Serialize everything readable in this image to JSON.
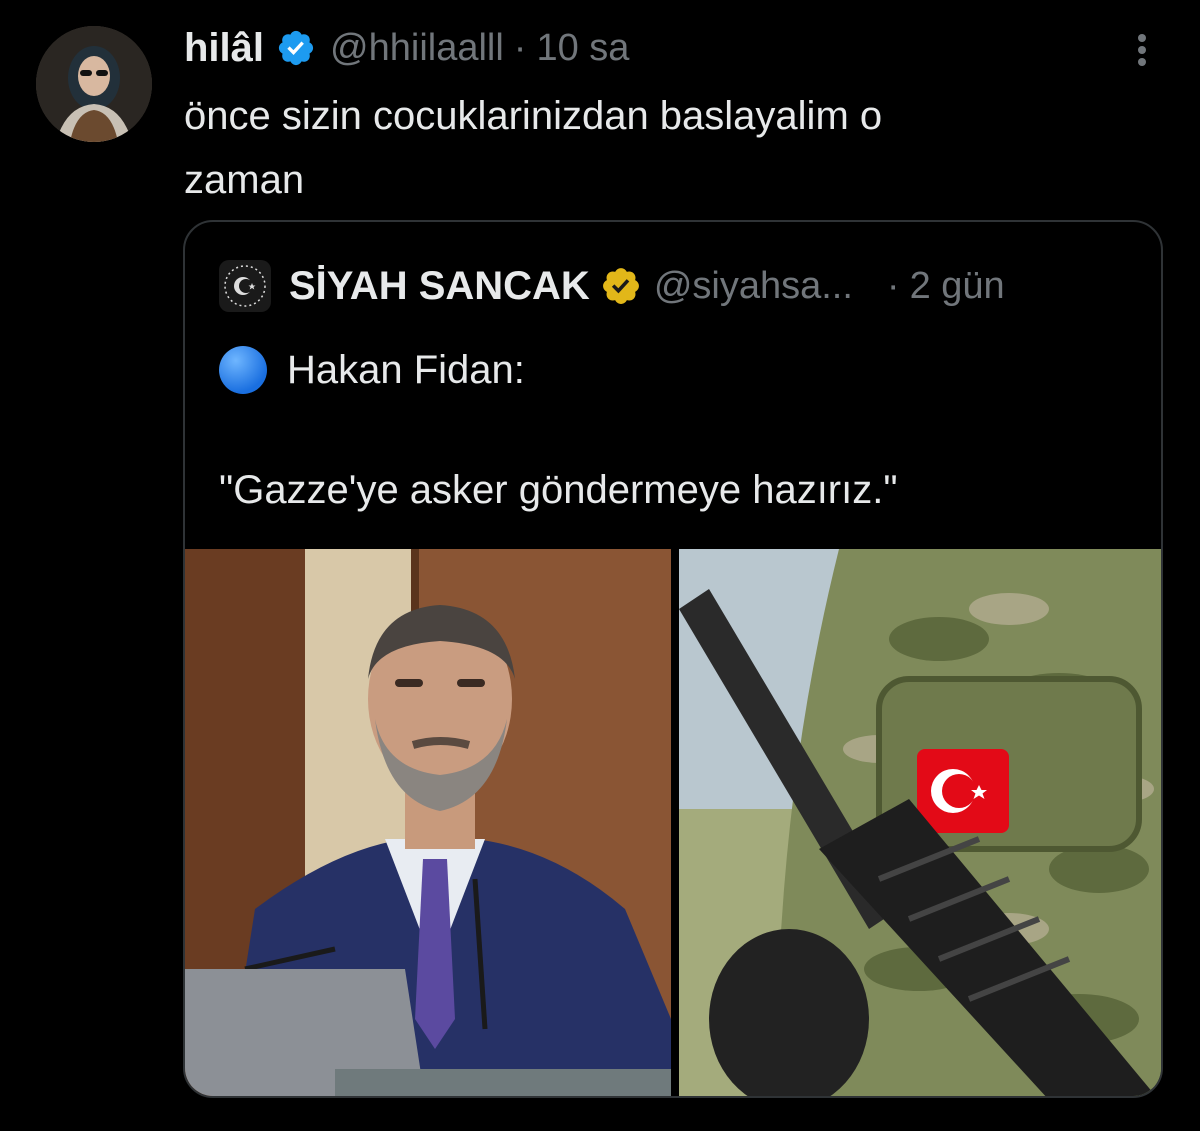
{
  "tweet": {
    "author_name": "hilâl",
    "handle": "@hhiilaalll",
    "separator": "·",
    "time": "10 sa",
    "text": "önce sizin cocuklarinizdan baslayalim o\nzaman",
    "avatar_icon": "profile-photo",
    "verified_icon": "verified-badge-blue",
    "more_icon": "more-options-icon"
  },
  "quoted": {
    "author_name": "SİYAH SANCAK",
    "handle": "@siyahsa...",
    "separator": "·",
    "time": "2 gün",
    "line1": "Hakan Fidan:",
    "line2": "\"Gazze'ye asker göndermeye hazırız.\"",
    "bullet_icon": "blue-circle-emoji",
    "verified_icon": "verified-badge-gold",
    "avatar_icon": "crescent-star-logo",
    "media": [
      {
        "description_icon": "man-at-podium-photo"
      },
      {
        "description_icon": "soldier-with-rifle-photo"
      }
    ]
  },
  "colors": {
    "background": "#000000",
    "text_primary": "#e7e9ea",
    "text_secondary": "#71767b",
    "border": "#2f3336",
    "verified_blue": "#1d9bf0",
    "verified_gold": "#e2b719",
    "flag_red": "#e30a17"
  }
}
